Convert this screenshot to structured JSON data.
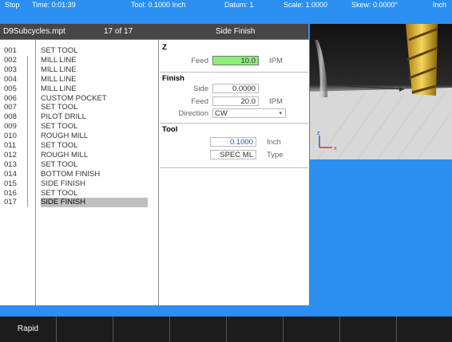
{
  "status": {
    "mode": "Stop",
    "time": "Time: 0:01:39",
    "tool": "Tool: 0.1000 Inch",
    "datum": "Datum: 1",
    "scale": "Scale: 1.0000",
    "skew": "Skew: 0.0000°",
    "units": "Inch"
  },
  "program": {
    "name": "D9Subcycles.mpt",
    "position": "17 of 17",
    "cycle": "Side Finish"
  },
  "steps": [
    {
      "num": "001",
      "op": "SET TOOL"
    },
    {
      "num": "002",
      "op": "MILL LINE"
    },
    {
      "num": "003",
      "op": "MILL LINE"
    },
    {
      "num": "004",
      "op": "MILL LINE"
    },
    {
      "num": "005",
      "op": "MILL LINE"
    },
    {
      "num": "006",
      "op": "CUSTOM POCKET"
    },
    {
      "num": "007",
      "op": "SET TOOL"
    },
    {
      "num": "008",
      "op": "PILOT DRILL"
    },
    {
      "num": "009",
      "op": "SET TOOL"
    },
    {
      "num": "010",
      "op": "ROUGH MILL"
    },
    {
      "num": "011",
      "op": "SET TOOL"
    },
    {
      "num": "012",
      "op": "ROUGH MILL"
    },
    {
      "num": "013",
      "op": "SET TOOL"
    },
    {
      "num": "014",
      "op": "BOTTOM FINISH"
    },
    {
      "num": "015",
      "op": "SIDE FINISH"
    },
    {
      "num": "016",
      "op": "SET TOOL"
    },
    {
      "num": "017",
      "op": "SIDE FINISH"
    }
  ],
  "selected_step": "017",
  "form": {
    "z": {
      "title": "Z",
      "feed_label": "Feed",
      "feed_value": "10.0",
      "feed_unit": "IPM"
    },
    "finish": {
      "title": "Finish",
      "side_label": "Side",
      "side_value": "0.0000",
      "feed_label": "Feed",
      "feed_value": "20.0",
      "feed_unit": "IPM",
      "direction_label": "Direction",
      "direction_value": "CW"
    },
    "tool": {
      "title": "Tool",
      "diameter_value": "0.1000",
      "diameter_unit": "Inch",
      "type_value": "SPEC ML",
      "type_label": "Type"
    }
  },
  "preview": {
    "axis_z": "z",
    "axis_x": "x"
  },
  "softkeys": [
    "Rapid",
    "",
    "",
    "",
    "",
    "",
    "",
    ""
  ]
}
